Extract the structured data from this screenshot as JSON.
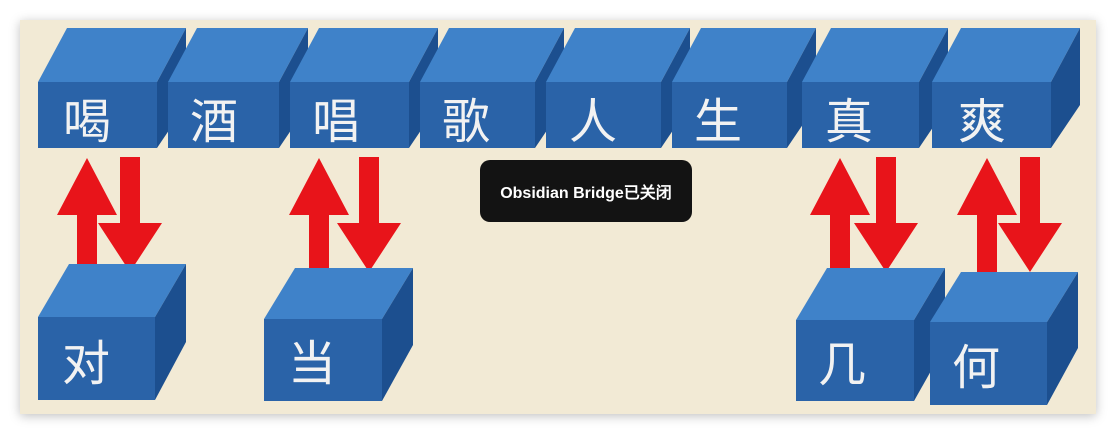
{
  "diagram": {
    "top_row": [
      "喝",
      "酒",
      "唱",
      "歌",
      "人",
      "生",
      "真",
      "爽"
    ],
    "bottom_row": [
      "对",
      "当",
      "几",
      "何"
    ]
  },
  "toast": {
    "message": "Obsidian Bridge已关闭"
  },
  "colors": {
    "background": "#f2ead5",
    "cube_front": "#2a63a8",
    "cube_top": "#3f82c9",
    "cube_side": "#1c4f8f",
    "arrow": "#e8141a",
    "toast_bg": "#131313"
  }
}
